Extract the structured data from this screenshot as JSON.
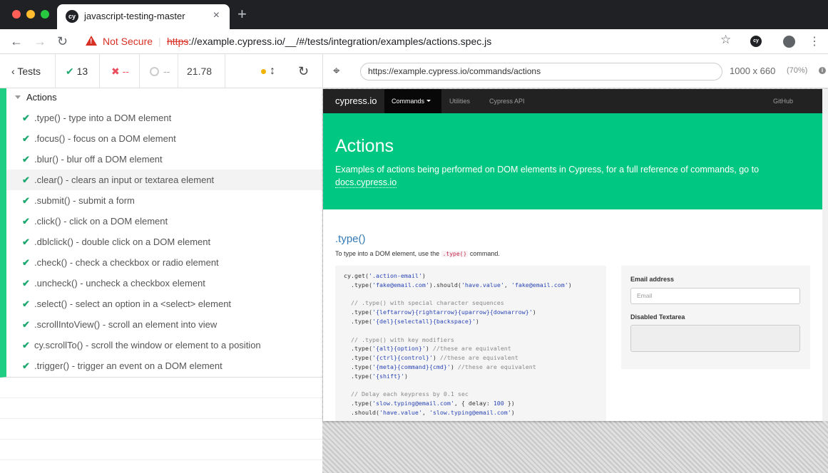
{
  "browser": {
    "tab_title": "javascript-testing-master",
    "tab_favicon": "cy",
    "security_label": "Not Secure",
    "url_scheme": "https",
    "url_rest": "://example.cypress.io/__/#/tests/integration/examples/actions.spec.js"
  },
  "runner": {
    "tests_label": "Tests",
    "passed": "13",
    "failed": "--",
    "pending": "--",
    "duration": "21.78"
  },
  "reporter": {
    "suite_title": "Actions",
    "tests": [
      ".type() - type into a DOM element",
      ".focus() - focus on a DOM element",
      ".blur() - blur off a DOM element",
      ".clear() - clears an input or textarea element",
      ".submit() - submit a form",
      ".click() - click on a DOM element",
      ".dblclick() - double click on a DOM element",
      ".check() - check a checkbox or radio element",
      ".uncheck() - uncheck a checkbox element",
      ".select() - select an option in a <select> element",
      ".scrollIntoView() - scroll an element into view",
      "cy.scrollTo() - scroll the window or element to a position",
      ".trigger() - trigger an event on a DOM element"
    ]
  },
  "aut": {
    "url": "https://example.cypress.io/commands/actions",
    "viewport_size": "1000 x 660",
    "viewport_scale": "(70%)"
  },
  "site": {
    "brand": "cypress.io",
    "nav": [
      "Commands",
      "Utilities",
      "Cypress API"
    ],
    "github": "GitHub",
    "hero_title": "Actions",
    "hero_text": "Examples of actions being performed on DOM elements in Cypress, for a full reference of commands, go to",
    "hero_link": "docs.cypress.io",
    "section_title": ".type()",
    "section_desc_pre": "To type into a DOM element, use the",
    "section_desc_code": ".type()",
    "section_desc_post": "command.",
    "form_email_label": "Email address",
    "form_email_placeholder": "Email",
    "form_textarea_label": "Disabled Textarea"
  },
  "colors": {
    "pass": "#1fa971",
    "fail": "#e94f5f",
    "accent": "#00c781",
    "nav_bg": "#222222"
  }
}
